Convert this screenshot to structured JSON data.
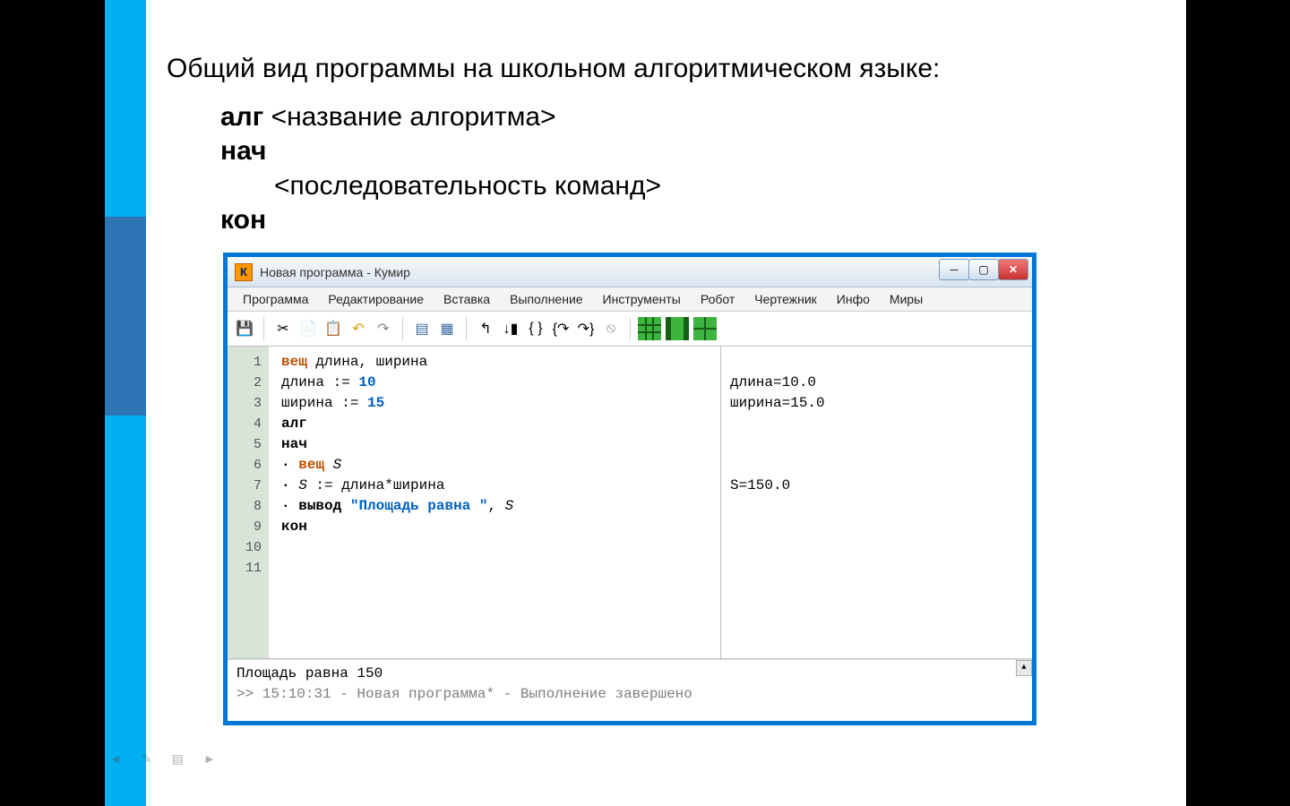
{
  "slide": {
    "title": "Общий вид программы на школьном алгоритмическом языке:",
    "line1_kw": "алг",
    "line1_rest": " <название алгоритма>",
    "line2_kw": "нач",
    "line3": "<последовательность команд>",
    "line4_kw": "кон"
  },
  "window": {
    "title": "Новая программа - Кумир",
    "menus": [
      "Программа",
      "Редактирование",
      "Вставка",
      "Выполнение",
      "Инструменты",
      "Робот",
      "Чертежник",
      "Инфо",
      "Миры"
    ],
    "code_lines": [
      {
        "n": "1",
        "html": "<span class='kw-o'>вещ</span> длина, ширина"
      },
      {
        "n": "2",
        "html": "длина := <span class='num'>10</span>"
      },
      {
        "n": "3",
        "html": "ширина := <span class='num'>15</span>"
      },
      {
        "n": "4",
        "html": "<span class='kw-b'>алг</span>"
      },
      {
        "n": "5",
        "html": "<span class='kw-b'>нач</span>"
      },
      {
        "n": "6",
        "html": "<span class='kw-b'>·</span> <span class='kw-o'>вещ</span> <span class='it'>S</span>"
      },
      {
        "n": "7",
        "html": "<span class='kw-b'>·</span> <span class='it'>S</span> := длина*ширина"
      },
      {
        "n": "8",
        "html": "<span class='kw-b'>·</span> <span class='kw-b'>вывод</span> <span class='str'>\"Площадь равна \"</span>, <span class='it'>S</span>"
      },
      {
        "n": "9",
        "html": "<span class='kw-b'>кон</span>"
      },
      {
        "n": "10",
        "html": ""
      },
      {
        "n": "11",
        "html": ""
      }
    ],
    "output": {
      "l1": "",
      "l2": "длина=10.0",
      "l3": "ширина=15.0",
      "l4": "",
      "l5": "",
      "l6": "",
      "l7": "S=150.0"
    },
    "console_line1": "Площадь равна 150",
    "console_line2": ">> 15:10:31 - Новая программа* - Выполнение завершено"
  }
}
